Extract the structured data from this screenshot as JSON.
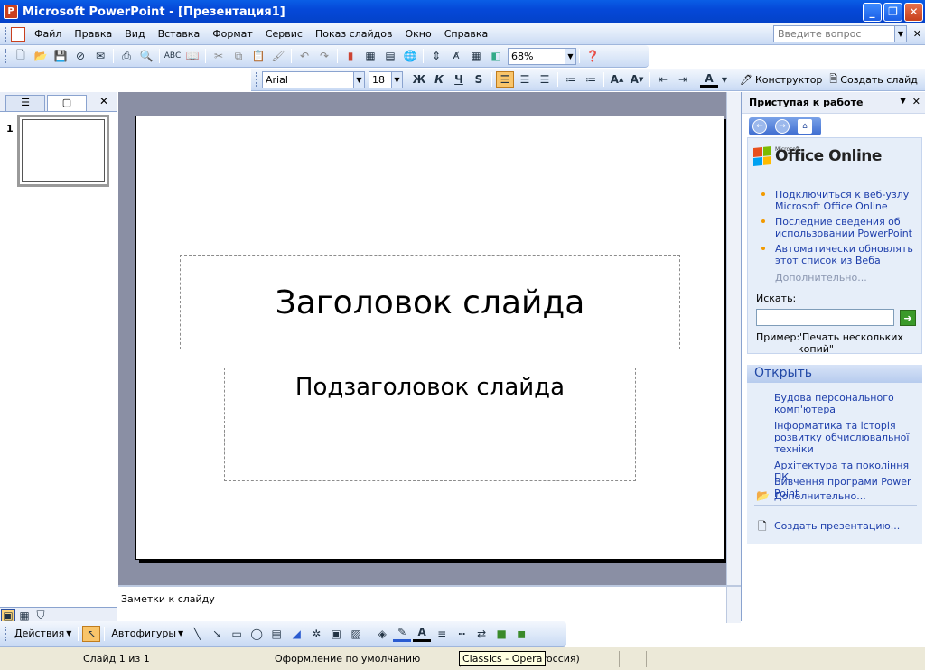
{
  "window": {
    "title": "Microsoft PowerPoint - [Презентация1]"
  },
  "menu": {
    "items": [
      "Файл",
      "Правка",
      "Вид",
      "Вставка",
      "Формат",
      "Сервис",
      "Показ слайдов",
      "Окно",
      "Справка"
    ],
    "help_placeholder": "Введите вопрос"
  },
  "toolbar": {
    "zoom": "68%"
  },
  "format_toolbar": {
    "font": "Arial",
    "size": "18",
    "bold": "Ж",
    "italic": "К",
    "underline": "Ч",
    "shadow": "S",
    "designer": "Конструктор",
    "new_slide": "Создать слайд"
  },
  "slides_panel": {
    "slide_number": "1"
  },
  "slide": {
    "title": "Заголовок слайда",
    "subtitle": "Подзаголовок слайда"
  },
  "notes": {
    "placeholder": "Заметки к слайду"
  },
  "taskpane": {
    "title": "Приступая к работе",
    "logo_small": "Microsoft",
    "logo_big": "Office Online",
    "links": [
      [
        "Подключиться к веб-узлу",
        "Microsoft Office Online"
      ],
      [
        "Последние сведения об",
        "использовании PowerPoint"
      ],
      [
        "Автоматически обновлять",
        "этот список из Веба"
      ]
    ],
    "more": "Дополнительно...",
    "search_label": "Искать:",
    "example_label": "Пример:",
    "example_text": [
      "\"Печать нескольких",
      "копий\""
    ],
    "open_header": "Открыть",
    "files": [
      [
        "Будова персонального",
        "комп'ютера"
      ],
      [
        "Інформатика та історія",
        "розвитку обчислювальної",
        "техніки"
      ],
      [
        "Архітектура та покоління ПК"
      ],
      [
        "Вивчення програми Power Point"
      ]
    ],
    "open_more": "Дополнительно...",
    "create": "Создать презентацию..."
  },
  "drawbar": {
    "actions": "Действия",
    "autoshapes": "Автофигуры"
  },
  "status": {
    "slide": "Слайд 1 из 1",
    "design": "Оформление по умолчанию",
    "lang": "(Россия)"
  },
  "tooltip": "Classics - Opera"
}
